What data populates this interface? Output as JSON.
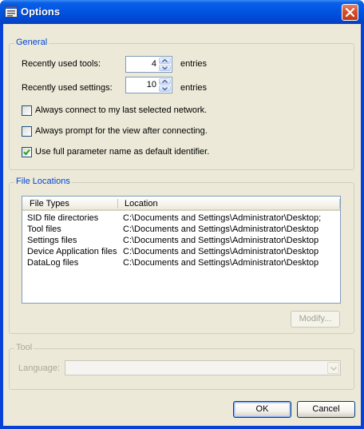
{
  "window": {
    "title": "Options",
    "title_icon": "options-window-icon",
    "close_icon": "close-icon"
  },
  "general": {
    "group_label": "General",
    "recent_tools_label": "Recently used tools:",
    "recent_tools_value": "4",
    "recent_tools_unit": "entries",
    "recent_settings_label": "Recently used settings:",
    "recent_settings_value": "10",
    "recent_settings_unit": "entries",
    "checkboxes": [
      {
        "label": "Always connect to my last selected network.",
        "checked": false
      },
      {
        "label": "Always prompt for the view after connecting.",
        "checked": false
      },
      {
        "label": "Use full parameter name as default identifier.",
        "checked": true
      }
    ]
  },
  "file_locations": {
    "group_label": "File Locations",
    "columns": [
      "File Types",
      "Location"
    ],
    "rows": [
      {
        "type": "SID file directories",
        "location": "C:\\Documents and Settings\\Administrator\\Desktop;"
      },
      {
        "type": "Tool files",
        "location": "C:\\Documents and Settings\\Administrator\\Desktop"
      },
      {
        "type": "Settings files",
        "location": "C:\\Documents and Settings\\Administrator\\Desktop"
      },
      {
        "type": "Device Application files",
        "location": "C:\\Documents and Settings\\Administrator\\Desktop"
      },
      {
        "type": "DataLog files",
        "location": "C:\\Documents and Settings\\Administrator\\Desktop"
      }
    ],
    "modify_label": "Modify..."
  },
  "tool": {
    "group_label": "Tool",
    "language_label": "Language:",
    "language_value": ""
  },
  "buttons": {
    "ok_label": "OK",
    "cancel_label": "Cancel"
  },
  "colors": {
    "titlebar": "#0053e0",
    "dialog_bg": "#ece9d8",
    "group_label": "#0046d5",
    "close_button": "#d4502a"
  }
}
